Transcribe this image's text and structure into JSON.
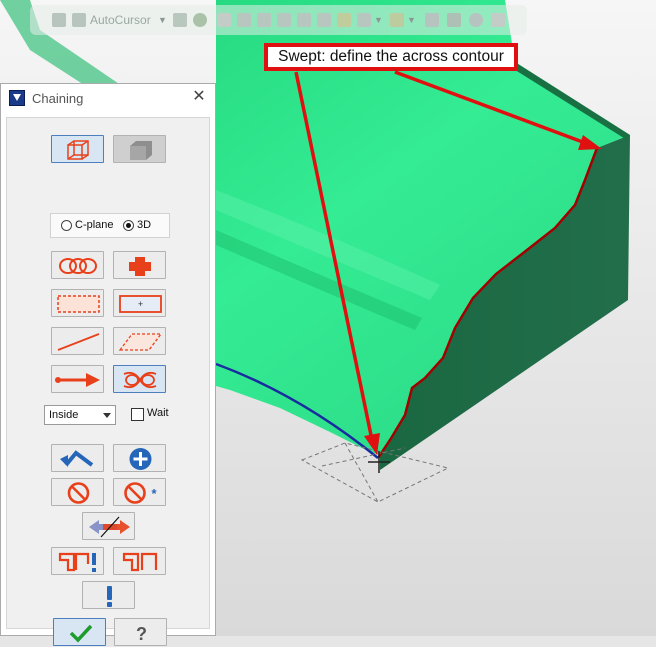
{
  "toolbar": {
    "autocursor_label": "AutoCursor",
    "icons": [
      "lock-icon",
      "autocursor-icon",
      "gear-icon",
      "select-arrow-icon",
      "view-cube-icons",
      "grid-icon",
      "layer-icons",
      "undo-icon"
    ]
  },
  "callout": {
    "text": "Swept: define the across contour"
  },
  "dialog": {
    "title": "Chaining",
    "close_glyph": "✕",
    "plane": {
      "cplane_label": "C-plane",
      "threed_label": "3D",
      "selected": "3D"
    },
    "mode": {
      "value": "Inside"
    },
    "wait": {
      "label": "Wait",
      "checked": false
    },
    "help_glyph": "?"
  },
  "colors": {
    "part_face": "#2ee68a",
    "part_side": "#1f6e48",
    "contour_red": "#b00000",
    "arrow_red": "#e11010",
    "button_orange": "#e8401a"
  }
}
